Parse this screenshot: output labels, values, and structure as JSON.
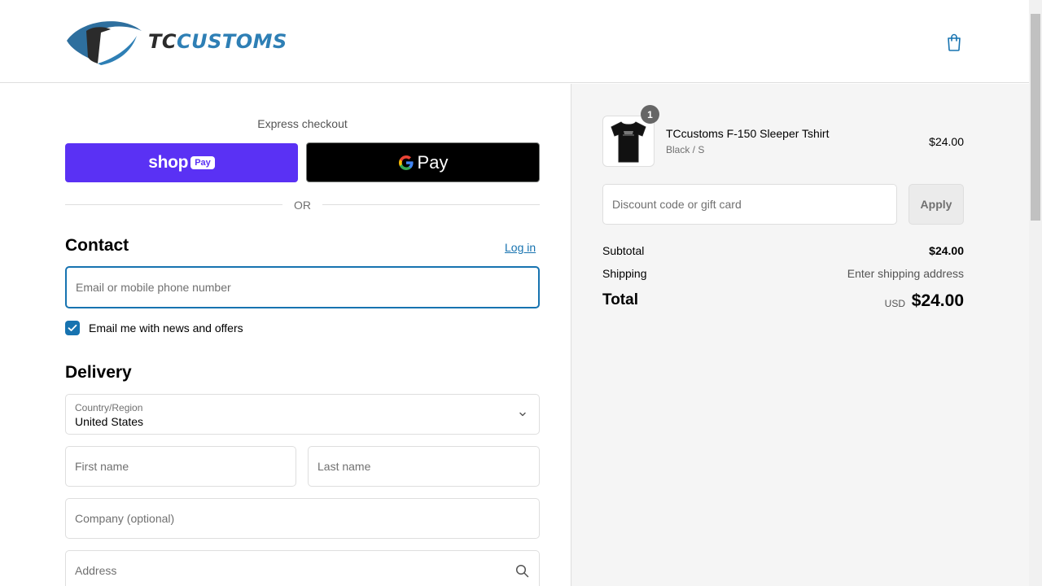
{
  "header": {
    "logo_text_dark": "TC",
    "logo_text_blue": "CUSTOMS",
    "cart_icon": "shopping-bag-icon"
  },
  "express": {
    "title": "Express checkout",
    "shop_pay": {
      "label": "shop",
      "badge": "Pay",
      "color": "#5a31f4"
    },
    "google_pay": {
      "label": "Pay",
      "icon": "google-g-icon"
    },
    "divider": "OR"
  },
  "contact": {
    "title": "Contact",
    "login_link": "Log in",
    "email_placeholder": "Email or mobile phone number",
    "newsletter_label": "Email me with news and offers",
    "newsletter_checked": true
  },
  "delivery": {
    "title": "Delivery",
    "country_label": "Country/Region",
    "country_value": "United States",
    "first_name_placeholder": "First name",
    "last_name_placeholder": "Last name",
    "company_placeholder": "Company (optional)",
    "address_placeholder": "Address"
  },
  "summary": {
    "item": {
      "quantity": "1",
      "name": "TCcustoms F-150 Sleeper Tshirt",
      "variant": "Black / S",
      "price": "$24.00"
    },
    "discount_placeholder": "Discount code or gift card",
    "apply_label": "Apply",
    "subtotal_label": "Subtotal",
    "subtotal_value": "$24.00",
    "shipping_label": "Shipping",
    "shipping_value": "Enter shipping address",
    "total_label": "Total",
    "currency": "USD",
    "total_value": "$24.00"
  },
  "colors": {
    "accent": "#1773b0",
    "brand_blue": "#2e7fb5",
    "summary_bg": "#f5f5f5"
  }
}
